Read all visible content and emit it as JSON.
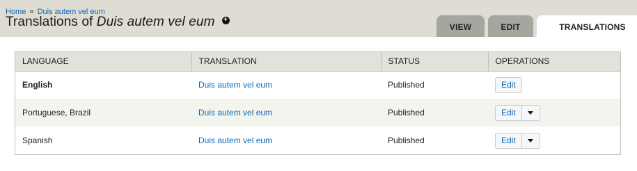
{
  "breadcrumb": {
    "items": [
      {
        "label": "Home"
      },
      {
        "label": "Duis autem vel eum"
      }
    ],
    "separator": "»"
  },
  "page": {
    "title_prefix": "Translations of ",
    "title_node": "Duis autem vel eum",
    "shortcut_icon": "plus-circle-icon"
  },
  "tabs": [
    {
      "label": "View",
      "active": false
    },
    {
      "label": "Edit",
      "active": false
    },
    {
      "label": "Translations",
      "active": true
    }
  ],
  "table": {
    "headers": [
      "Language",
      "Translation",
      "Status",
      "Operations"
    ],
    "rows": [
      {
        "language": "English",
        "translation": "Duis autem vel eum",
        "status": "Published",
        "operation": "Edit",
        "has_dropdown": false,
        "is_default": true
      },
      {
        "language": "Portuguese, Brazil",
        "translation": "Duis autem vel eum",
        "status": "Published",
        "operation": "Edit",
        "has_dropdown": true,
        "is_default": false
      },
      {
        "language": "Spanish",
        "translation": "Duis autem vel eum",
        "status": "Published",
        "operation": "Edit",
        "has_dropdown": true,
        "is_default": false
      }
    ]
  },
  "colors": {
    "header_bg": "#dedcd3",
    "link": "#0d67b5",
    "tab_inactive": "#a6a6a0",
    "row_stripe": "#f3f4ee"
  }
}
